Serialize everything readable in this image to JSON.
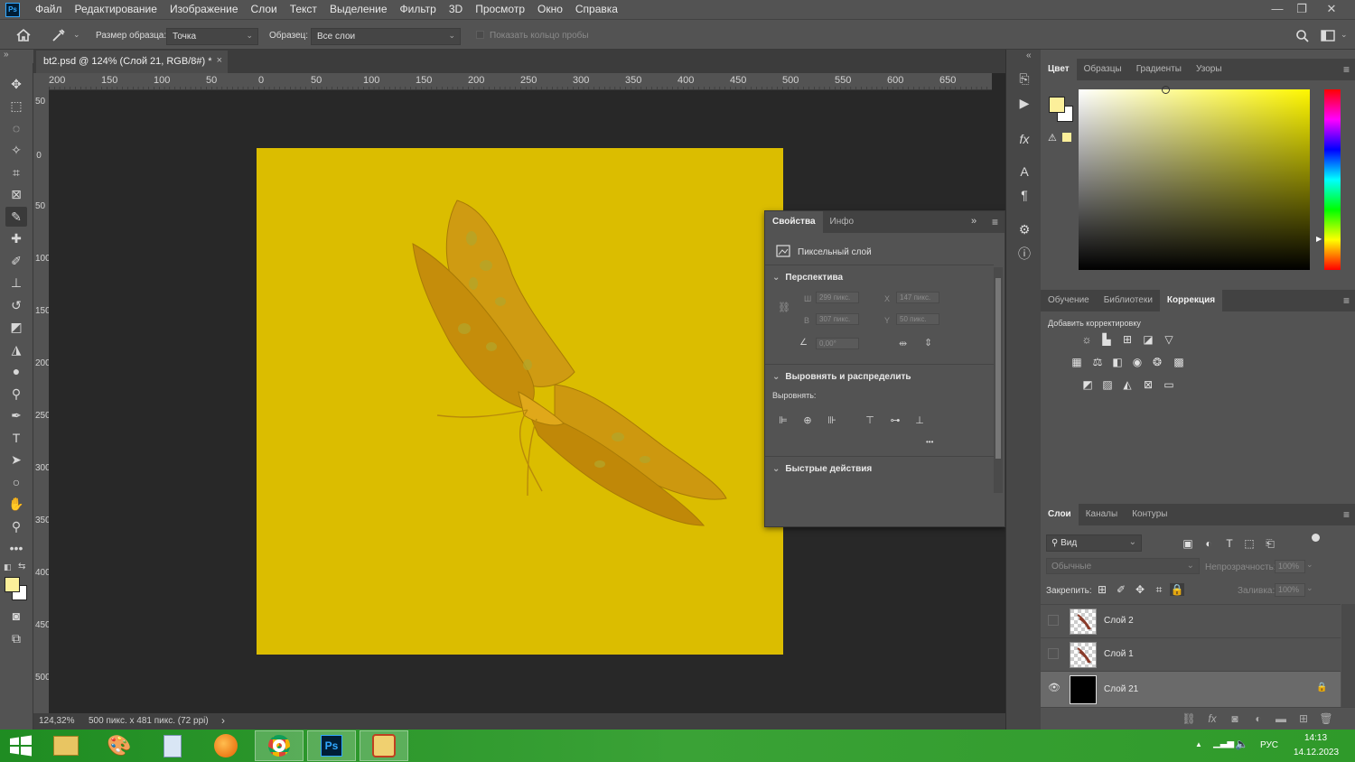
{
  "app": {
    "logo": "Ps"
  },
  "menu": [
    "Файл",
    "Редактирование",
    "Изображение",
    "Слои",
    "Текст",
    "Выделение",
    "Фильтр",
    "3D",
    "Просмотр",
    "Окно",
    "Справка"
  ],
  "window_controls": {
    "minimize": "—",
    "restore": "❐",
    "close": "✕"
  },
  "options_bar": {
    "sample_size_label": "Размер образца:",
    "sample_size_value": "Точка",
    "sample_label": "Образец:",
    "sample_value": "Все слои",
    "show_ring_label": "Показать кольцо пробы"
  },
  "document": {
    "tab_title": "bt2.psd @ 124% (Слой 21, RGB/8#) *",
    "close": "×",
    "canvas_color": "#dbbd00"
  },
  "ruler_h": [
    "200",
    "150",
    "100",
    "50",
    "0",
    "50",
    "100",
    "150",
    "200",
    "250",
    "300",
    "350",
    "400",
    "450",
    "500",
    "550",
    "600",
    "650"
  ],
  "ruler_v": [
    "50",
    "0",
    "50",
    "100",
    "150",
    "200",
    "250",
    "300",
    "350",
    "400",
    "450",
    "500"
  ],
  "status": {
    "zoom": "124,32%",
    "doc_info": "500 пикс. x 481 пикс. (72 ppi)",
    "arrow": "›"
  },
  "color_panel": {
    "tabs": [
      "Цвет",
      "Образцы",
      "Градиенты",
      "Узоры"
    ],
    "foreground": "#fcef9a",
    "background": "#ffffff"
  },
  "adjust_panel": {
    "tabs": [
      "Обучение",
      "Библиотеки",
      "Коррекция"
    ],
    "add_label": "Добавить корректировку"
  },
  "layers_panel": {
    "tabs": [
      "Слои",
      "Каналы",
      "Контуры"
    ],
    "filter_label": "Вид",
    "blend_mode": "Обычные",
    "opacity_label": "Непрозрачность:",
    "opacity_value": "100%",
    "lock_label": "Закрепить:",
    "fill_label": "Заливка:",
    "fill_value": "100%",
    "layers": [
      {
        "name": "Слой 2",
        "visible": false,
        "selected": false
      },
      {
        "name": "Слой 1",
        "visible": false,
        "selected": false
      },
      {
        "name": "Слой 21",
        "visible": true,
        "selected": true
      }
    ]
  },
  "properties_panel": {
    "tabs": [
      "Свойства",
      "Инфо"
    ],
    "layer_type": "Пиксельный слой",
    "perspective_title": "Перспектива",
    "w_label": "Ш",
    "w_value": "299 пикс.",
    "h_label": "В",
    "h_value": "307 пикс.",
    "x_label": "X",
    "x_value": "147 пикс.",
    "y_label": "Y",
    "y_value": "50 пикс.",
    "angle_value": "0,00°",
    "align_title": "Выровнять и распределить",
    "align_label": "Выровнять:",
    "more": "•••",
    "quick_title": "Быстрые действия"
  },
  "taskbar": {
    "lang": "РУС",
    "time": "14:13",
    "date": "14.12.2023"
  }
}
